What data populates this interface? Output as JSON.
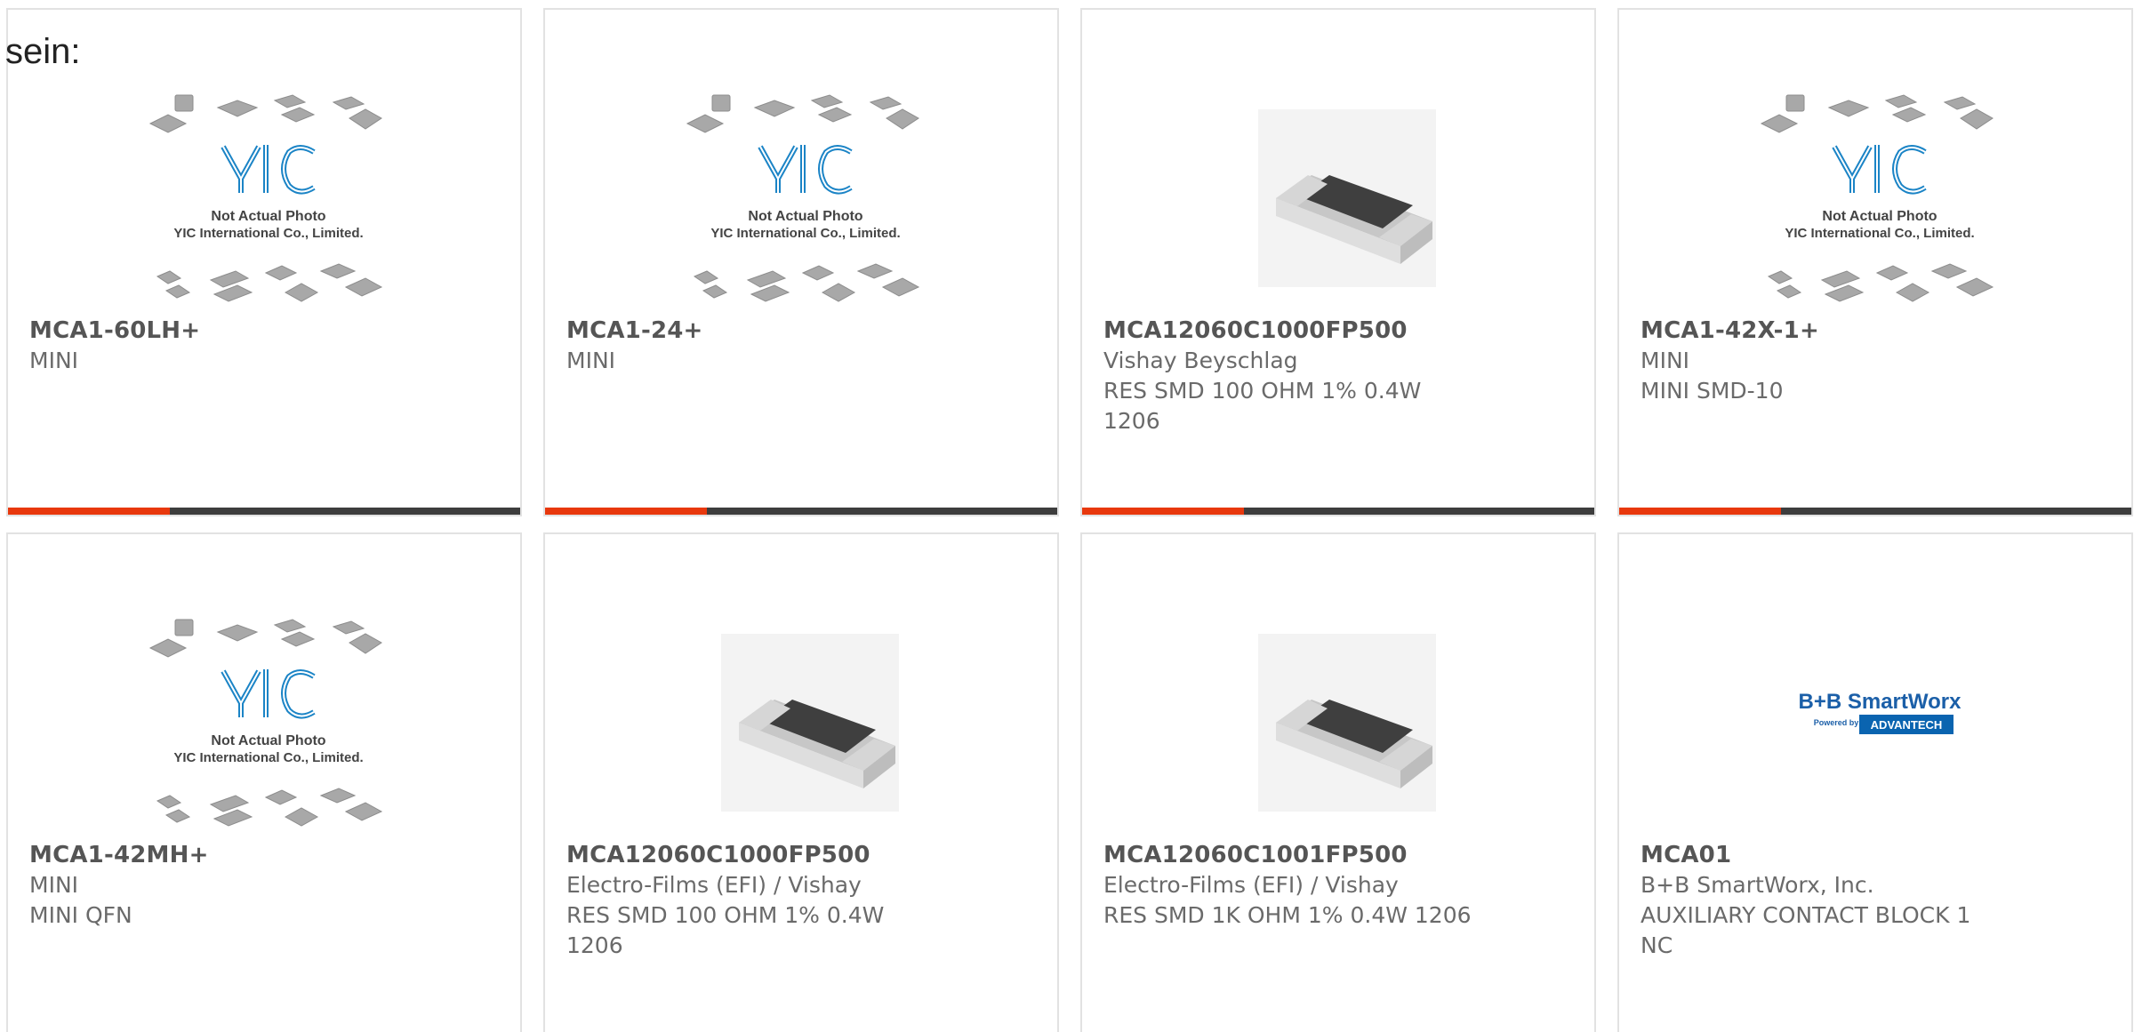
{
  "fragment_text": "sein:",
  "colors": {
    "accent": "#e8380d",
    "bar": "#3d3d3d",
    "border": "#e2e2e2",
    "yic_blue": "#1b84c6",
    "advantech_blue": "#0a64b0"
  },
  "products": [
    {
      "part": "MCA1-60LH+",
      "lines": [
        "MINI",
        ""
      ],
      "image": "yic-not-actual-photo"
    },
    {
      "part": "MCA1-24+",
      "lines": [
        "MINI",
        ""
      ],
      "image": "yic-not-actual-photo"
    },
    {
      "part": "MCA12060C1000FP500",
      "lines": [
        "Vishay Beyschlag",
        "RES SMD 100 OHM 1% 0.4W",
        "1206"
      ],
      "image": "smd-resistor"
    },
    {
      "part": "MCA1-42X-1+",
      "lines": [
        "MINI",
        "MINI SMD-10"
      ],
      "image": "yic-not-actual-photo"
    },
    {
      "part": "MCA1-42MH+",
      "lines": [
        "MINI",
        "MINI QFN"
      ],
      "image": "yic-not-actual-photo"
    },
    {
      "part": "MCA12060C1000FP500",
      "lines": [
        "Electro-Films (EFI) / Vishay",
        "RES SMD 100 OHM 1% 0.4W",
        "1206"
      ],
      "image": "smd-resistor"
    },
    {
      "part": "MCA12060C1001FP500",
      "lines": [
        "Electro-Films (EFI) / Vishay",
        "RES SMD 1K OHM 1% 0.4W 1206",
        ""
      ],
      "image": "smd-resistor"
    },
    {
      "part": "MCA01",
      "lines": [
        "B+B SmartWorx, Inc.",
        "AUXILIARY CONTACT BLOCK 1",
        "NC"
      ],
      "image": "bb-smartworx-logo"
    }
  ],
  "yic_logo": {
    "brand": "YIC",
    "caption1": "Not Actual Photo",
    "caption2": "YIC International Co., Limited."
  },
  "bb_logo": {
    "brand": "B+B SmartWorx",
    "powered_by": "Powered by",
    "partner": "ADVANTECH"
  }
}
